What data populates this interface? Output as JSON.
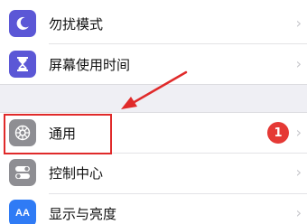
{
  "settings": {
    "items": [
      {
        "label": "勿扰模式",
        "icon": "moon-icon",
        "icon_color": "#5b57d6"
      },
      {
        "label": "屏幕使用时间",
        "icon": "hourglass-icon",
        "icon_color": "#5b57d6"
      },
      {
        "label": "通用",
        "icon": "gear-icon",
        "icon_color": "#8e8e93",
        "badge": "1",
        "badge_color": "#e53935"
      },
      {
        "label": "控制中心",
        "icon": "switches-icon",
        "icon_color": "#8e8e93"
      },
      {
        "label": "显示与亮度",
        "icon": "aa-icon",
        "icon_color": "#2f7bf5",
        "icon_text": "AA"
      }
    ]
  },
  "annotation": {
    "color": "#e02a2a"
  }
}
